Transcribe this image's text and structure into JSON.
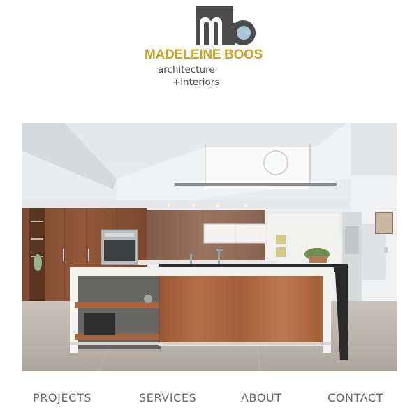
{
  "brand": {
    "monogram": "mb",
    "name": "MADELEINE BOOS",
    "tagline_line1": "architecture",
    "tagline_line2": "+interiors",
    "colors": {
      "gold": "#c9a227",
      "charcoal": "#4a4a4a",
      "accent_blue": "#a9c5d6"
    }
  },
  "hero": {
    "subject": "kitchen-photo"
  },
  "nav": {
    "items": [
      {
        "label": "PROJECTS"
      },
      {
        "label": "SERVICES"
      },
      {
        "label": "ABOUT"
      },
      {
        "label": "CONTACT"
      }
    ]
  }
}
